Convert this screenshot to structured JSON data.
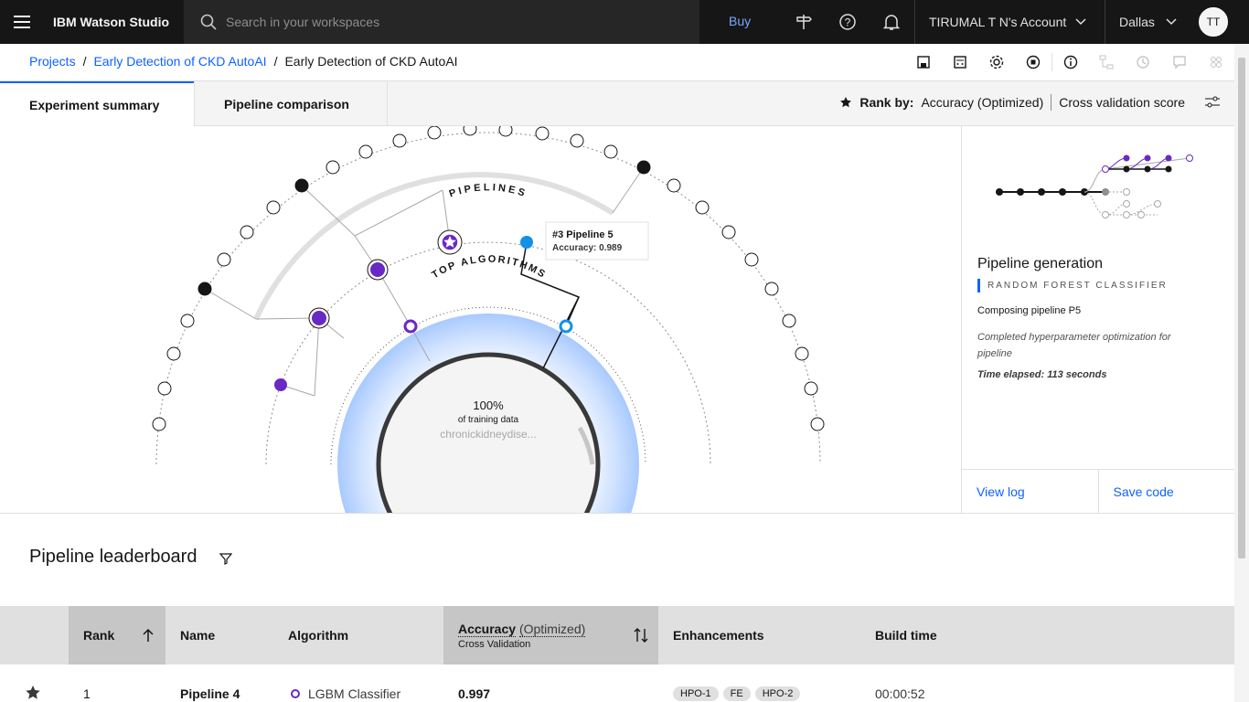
{
  "header": {
    "brand": "IBM Watson Studio",
    "search_placeholder": "Search in your workspaces",
    "buy": "Buy",
    "account": "TIRUMAL T N's Account",
    "region": "Dallas",
    "avatar": "TT"
  },
  "breadcrumbs": [
    "Projects",
    "Early Detection of CKD AutoAI",
    "Early Detection of CKD AutoAI"
  ],
  "tabs": [
    "Experiment summary",
    "Pipeline comparison"
  ],
  "rank": {
    "label": "Rank by:",
    "metric": "Accuracy (Optimized)",
    "score": "Cross validation score"
  },
  "viz": {
    "pipelines_label": "PIPELINES",
    "algorithms_label": "TOP ALGORITHMS",
    "center_value": "100%",
    "center_caption": "of training data",
    "dataset": "chronickidneydise...",
    "tooltip_title": "#3 Pipeline 5",
    "tooltip_accuracy": "Accuracy: 0.989"
  },
  "side": {
    "title": "Pipeline generation",
    "subtitle": "RANDOM FOREST CLASSIFIER",
    "status": "Composing pipeline P5",
    "info": "Completed hyperparameter optimization for pipeline",
    "time": "Time elapsed: 113 seconds",
    "view_log": "View log",
    "save_code": "Save code"
  },
  "leaderboard": {
    "title": "Pipeline leaderboard",
    "columns": {
      "rank": "Rank",
      "name": "Name",
      "algorithm": "Algorithm",
      "accuracy": "Accuracy",
      "optimized": "(Optimized)",
      "cv": "Cross Validation",
      "enhancements": "Enhancements",
      "build": "Build time"
    },
    "rows": [
      {
        "rank": "1",
        "name": "Pipeline 4",
        "algorithm": "LGBM Classifier",
        "accuracy": "0.997",
        "enh": [
          "HPO-1",
          "FE",
          "HPO-2"
        ],
        "time": "00:00:52"
      }
    ]
  },
  "colors": {
    "accent": "#0f62fe",
    "purple": "#6929c4",
    "cyan": "#1192e8"
  }
}
